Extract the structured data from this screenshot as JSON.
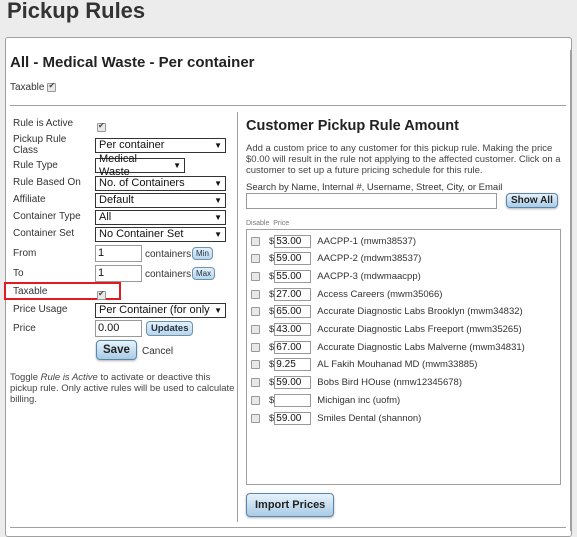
{
  "page_title": "Pickup Rules",
  "rule_title": "All - Medical Waste - Per container",
  "taxable_top": {
    "label": "Taxable",
    "checked": true
  },
  "form": {
    "rule_is_active": {
      "label": "Rule is Active",
      "checked": true
    },
    "pickup_rule_class": {
      "label_line1": "Pickup Rule",
      "label_line2": "Class",
      "value": "Per container"
    },
    "rule_type": {
      "label": "Rule Type",
      "value": "Medical Waste"
    },
    "rule_based_on": {
      "label": "Rule Based On",
      "value": "No. of Containers"
    },
    "affiliate": {
      "label": "Affiliate",
      "value": "Default"
    },
    "container_type": {
      "label": "Container Type",
      "value": "All"
    },
    "container_set": {
      "label": "Container Set",
      "value": "No Container Set"
    },
    "from": {
      "label": "From",
      "value": "1",
      "unit": "containers",
      "button": "Min"
    },
    "to": {
      "label": "To",
      "value": "1",
      "unit": "containers",
      "button": "Max"
    },
    "taxable": {
      "label": "Taxable",
      "checked": true
    },
    "price_usage": {
      "label": "Price Usage",
      "value": "Per Container (for only"
    },
    "price": {
      "label": "Price",
      "value": "0.00",
      "button": "Updates"
    },
    "save_label": "Save",
    "cancel_label": "Cancel",
    "arrow_glyph": "▼"
  },
  "help": {
    "prefix": "Toggle ",
    "em": "Rule is Active",
    "suffix": " to activate or deactive this pickup rule. Only active rules will be used to calculate billing."
  },
  "customer": {
    "title": "Customer Pickup Rule Amount",
    "description": "Add a custom price to any customer for this pickup rule. Making the price $0.00 will result in the rule not applying to the affected customer. Click on a customer to set up a future pricing schedule for this rule.",
    "search_label": "Search by Name, Internal #, Username, Street, City, or Email",
    "search_value": "",
    "show_all_label": "Show All",
    "col_disable": "Disable",
    "col_price": "Price",
    "currency": "$",
    "rows": [
      {
        "price": "53.00",
        "name": "AACPP-1 (mwm38537)"
      },
      {
        "price": "59.00",
        "name": "AACPP-2 (mdwm38537)"
      },
      {
        "price": "55.00",
        "name": "AACPP-3 (mdwmaacpp)"
      },
      {
        "price": "27.00",
        "name": "Access Careers (mwm35066)"
      },
      {
        "price": "65.00",
        "name": "Accurate Diagnostic Labs Brooklyn (mwm34832)"
      },
      {
        "price": "43.00",
        "name": "Accurate Diagnostic Labs Freeport (mwm35265)"
      },
      {
        "price": "67.00",
        "name": "Accurate Diagnostic Labs Malverne (mwm34831)"
      },
      {
        "price": "9.25",
        "name": "AL Fakih Mouhanad MD (mwm33885)"
      },
      {
        "price": "59.00",
        "name": "Bobs Bird HOuse (nmw12345678)"
      },
      {
        "price": "",
        "name": "Michigan inc (uofm)"
      },
      {
        "price": "59.00",
        "name": "Smiles Dental (shannon)"
      }
    ],
    "import_label": "Import Prices"
  }
}
